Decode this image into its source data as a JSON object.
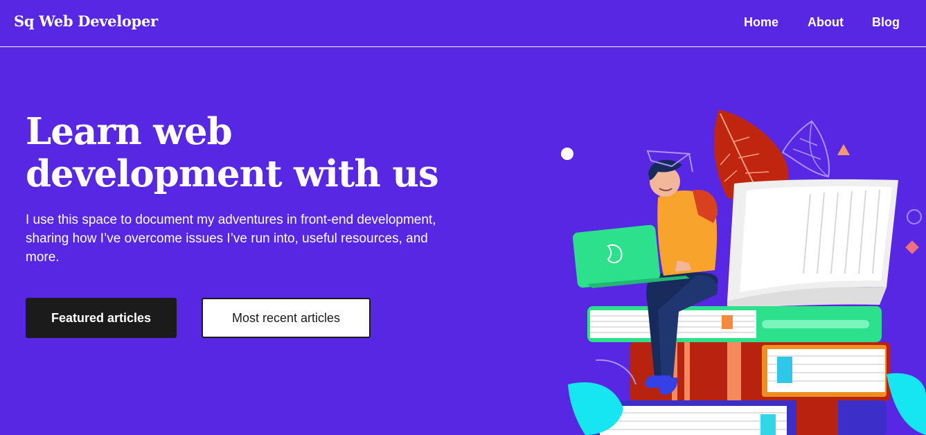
{
  "header": {
    "brand": "Sq Web Developer",
    "nav": [
      {
        "label": "Home"
      },
      {
        "label": "About"
      },
      {
        "label": "Blog"
      }
    ]
  },
  "hero": {
    "title": "Learn web development with us",
    "description": "I use this space to document my adventures in front-end development, sharing how I’ve overcome issues I’ve run into, useful resources, and more.",
    "buttons": {
      "featured": "Featured articles",
      "recent": "Most recent articles"
    }
  },
  "colors": {
    "background": "#5727e3",
    "primary_button": "#1b1b1b",
    "secondary_button": "#ffffff"
  },
  "illustration": {
    "icon": "student-with-laptop-on-books-illustration"
  }
}
